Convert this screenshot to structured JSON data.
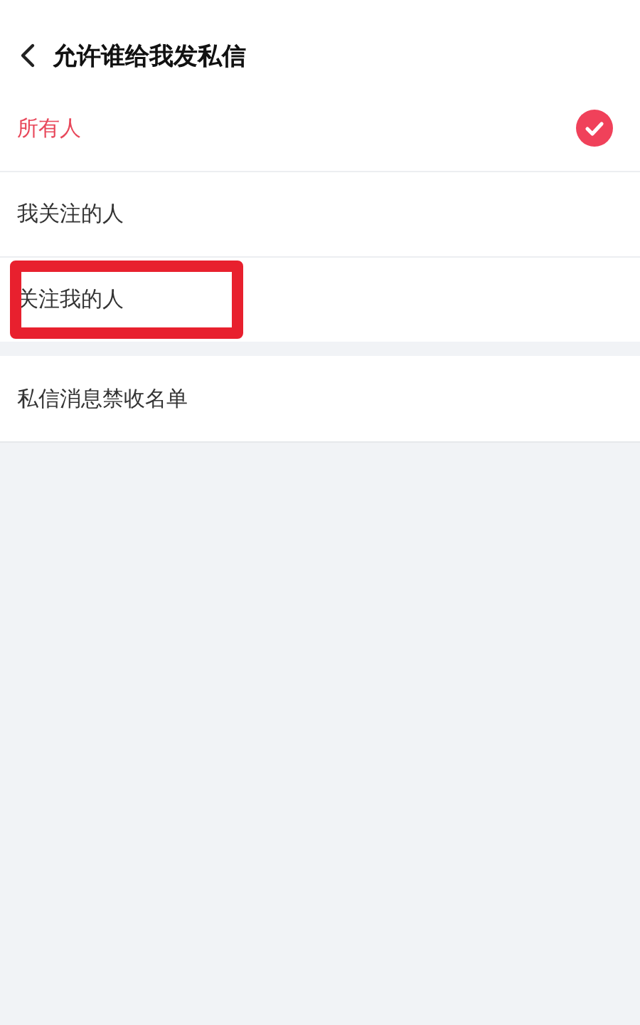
{
  "header": {
    "title": "允许谁给我发私信"
  },
  "options": [
    {
      "label": "所有人",
      "selected": true,
      "highlighted": false
    },
    {
      "label": "我关注的人",
      "selected": false,
      "highlighted": false
    },
    {
      "label": "关注我的人",
      "selected": false,
      "highlighted": true
    }
  ],
  "block_list": {
    "label": "私信消息禁收名单"
  }
}
